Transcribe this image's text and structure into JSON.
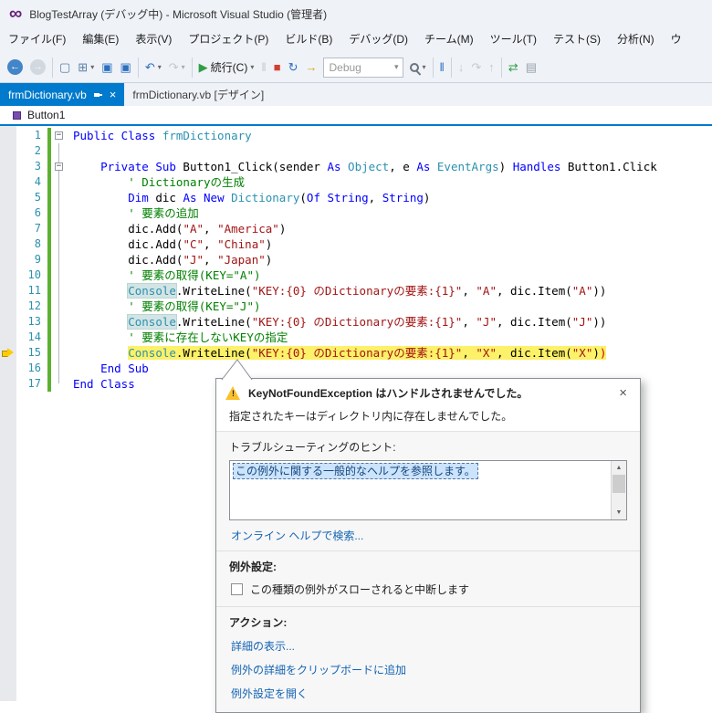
{
  "colors": {
    "accent": "#007acc",
    "keyword": "#0000ff",
    "type": "#2b91af",
    "string": "#a31515",
    "comment": "#008000",
    "current_statement_highlight": "#fcf168",
    "link": "#1464b4",
    "change_bar": "#5bb12f"
  },
  "titlebar": {
    "title": "BlogTestArray (デバッグ中) - Microsoft Visual Studio (管理者)"
  },
  "menubar": {
    "items": [
      "ファイル(F)",
      "編集(E)",
      "表示(V)",
      "プロジェクト(P)",
      "ビルド(B)",
      "デバッグ(D)",
      "チーム(M)",
      "ツール(T)",
      "テスト(S)",
      "分析(N)",
      "ウ"
    ]
  },
  "toolbar": {
    "items": [
      {
        "name": "navigate-backward-button",
        "glyph": "←",
        "style": "circle-blue"
      },
      {
        "name": "navigate-forward-button",
        "glyph": "→",
        "style": "circle-gray",
        "disabled": true
      },
      {
        "sep": true
      },
      {
        "name": "new-window-button",
        "glyph": "▢",
        "style": "steel"
      },
      {
        "name": "add-new-item-button",
        "glyph": "⊞",
        "style": "steel",
        "dropdown": true
      },
      {
        "name": "save-button",
        "glyph": "▣",
        "style": "blue"
      },
      {
        "name": "save-all-button",
        "glyph": "▣",
        "style": "blue"
      },
      {
        "sep": true
      },
      {
        "name": "undo-button",
        "glyph": "↶",
        "style": "blue",
        "dropdown": true
      },
      {
        "name": "redo-button",
        "glyph": "↷",
        "style": "gray",
        "dropdown": true,
        "disabled": true
      },
      {
        "sep": true
      },
      {
        "name": "continue-button",
        "glyph": "▶",
        "style": "green",
        "label": "続行(C)",
        "dropdown": true
      },
      {
        "name": "break-all-button",
        "glyph": "‖",
        "style": "gray",
        "disabled": true
      },
      {
        "name": "stop-debugging-button",
        "glyph": "■",
        "style": "red"
      },
      {
        "name": "restart-button",
        "glyph": "↻",
        "style": "blue"
      },
      {
        "name": "show-next-statement-button",
        "glyph": "→",
        "style": "yellow"
      },
      {
        "combo": true,
        "name": "solution-configuration-combo",
        "value": "Debug"
      },
      {
        "name": "find-button",
        "style": "mag",
        "dropdown": true
      },
      {
        "sep": true
      },
      {
        "name": "break-all-2-button",
        "glyph": "‖",
        "style": "blue"
      },
      {
        "sep": true
      },
      {
        "name": "step-into-button",
        "glyph": "↓",
        "style": "gray",
        "disabled": true
      },
      {
        "name": "step-over-button",
        "glyph": "↷",
        "style": "gray",
        "disabled": true
      },
      {
        "name": "step-out-button",
        "glyph": "↑",
        "style": "gray",
        "disabled": true
      },
      {
        "sep": true
      },
      {
        "name": "sync-button",
        "glyph": "⇄",
        "style": "green"
      },
      {
        "name": "list-button",
        "glyph": "▤",
        "style": "gray"
      }
    ]
  },
  "tabs": [
    {
      "label": "frmDictionary.vb",
      "active": true
    },
    {
      "label": "frmDictionary.vb [デザイン]",
      "active": false
    }
  ],
  "navbar": {
    "scope": "Button1"
  },
  "editor": {
    "current_line": 15,
    "lines": [
      {
        "n": 1,
        "fold": true,
        "indent": 0,
        "tokens": [
          [
            "Public Class ",
            "kw"
          ],
          [
            "frmDictionary",
            "type"
          ]
        ]
      },
      {
        "n": 2,
        "indent": 0,
        "tokens": []
      },
      {
        "n": 3,
        "fold": true,
        "indent": 4,
        "tokens": [
          [
            "Private Sub ",
            "kw"
          ],
          [
            "Button1_Click(sender ",
            "plain"
          ],
          [
            "As ",
            "kw"
          ],
          [
            "Object",
            "type"
          ],
          [
            ", e ",
            "plain"
          ],
          [
            "As ",
            "kw"
          ],
          [
            "EventArgs",
            "type"
          ],
          [
            ") ",
            "plain"
          ],
          [
            "Handles ",
            "kw"
          ],
          [
            "Button1.Click",
            "plain"
          ]
        ]
      },
      {
        "n": 4,
        "indent": 8,
        "tokens": [
          [
            "' Dictionaryの生成",
            "com"
          ]
        ]
      },
      {
        "n": 5,
        "indent": 8,
        "tokens": [
          [
            "Dim ",
            "kw"
          ],
          [
            "dic ",
            "plain"
          ],
          [
            "As New ",
            "kw"
          ],
          [
            "Dictionary",
            "type"
          ],
          [
            "(",
            "plain"
          ],
          [
            "Of ",
            "kw"
          ],
          [
            "String",
            "kw"
          ],
          [
            ", ",
            "plain"
          ],
          [
            "String",
            "kw"
          ],
          [
            ")",
            "plain"
          ]
        ]
      },
      {
        "n": 6,
        "indent": 8,
        "tokens": [
          [
            "' 要素の追加",
            "com"
          ]
        ]
      },
      {
        "n": 7,
        "indent": 8,
        "tokens": [
          [
            "dic.Add(",
            "plain"
          ],
          [
            "\"A\"",
            "str"
          ],
          [
            ", ",
            "plain"
          ],
          [
            "\"America\"",
            "str"
          ],
          [
            ")",
            "plain"
          ]
        ]
      },
      {
        "n": 8,
        "indent": 8,
        "tokens": [
          [
            "dic.Add(",
            "plain"
          ],
          [
            "\"C\"",
            "str"
          ],
          [
            ", ",
            "plain"
          ],
          [
            "\"China\"",
            "str"
          ],
          [
            ")",
            "plain"
          ]
        ]
      },
      {
        "n": 9,
        "indent": 8,
        "tokens": [
          [
            "dic.Add(",
            "plain"
          ],
          [
            "\"J\"",
            "str"
          ],
          [
            ", ",
            "plain"
          ],
          [
            "\"Japan\"",
            "str"
          ],
          [
            ")",
            "plain"
          ]
        ]
      },
      {
        "n": 10,
        "indent": 8,
        "tokens": [
          [
            "' 要素の取得(KEY=\"A\")",
            "com"
          ]
        ]
      },
      {
        "n": 11,
        "indent": 8,
        "tokens": [
          [
            "Console",
            "typehl"
          ],
          [
            ".WriteLine(",
            "plain"
          ],
          [
            "\"KEY:{0} のDictionaryの要素:{1}\"",
            "str"
          ],
          [
            ", ",
            "plain"
          ],
          [
            "\"A\"",
            "str"
          ],
          [
            ", dic.Item(",
            "plain"
          ],
          [
            "\"A\"",
            "str"
          ],
          [
            "))",
            "plain"
          ]
        ]
      },
      {
        "n": 12,
        "indent": 8,
        "tokens": [
          [
            "' 要素の取得(KEY=\"J\")",
            "com"
          ]
        ]
      },
      {
        "n": 13,
        "indent": 8,
        "tokens": [
          [
            "Console",
            "typehl"
          ],
          [
            ".WriteLine(",
            "plain"
          ],
          [
            "\"KEY:{0} のDictionaryの要素:{1}\"",
            "str"
          ],
          [
            ", ",
            "plain"
          ],
          [
            "\"J\"",
            "str"
          ],
          [
            ", dic.Item(",
            "plain"
          ],
          [
            "\"J\"",
            "str"
          ],
          [
            "))",
            "plain"
          ]
        ]
      },
      {
        "n": 14,
        "indent": 8,
        "tokens": [
          [
            "' 要素に存在しないKEYの指定",
            "com"
          ]
        ]
      },
      {
        "n": 15,
        "indent": 8,
        "tokens": [
          [
            "Console",
            "type"
          ],
          [
            ".WriteLine(",
            "plain"
          ],
          [
            "\"KEY:{0} のDictionaryの要素:{1}\"",
            "str"
          ],
          [
            ", ",
            "plain"
          ],
          [
            "\"X\"",
            "str"
          ],
          [
            ", dic.Item(",
            "plain"
          ],
          [
            "\"X\"",
            "str"
          ],
          [
            ")",
            "plain"
          ],
          [
            ")",
            "err"
          ]
        ]
      },
      {
        "n": 16,
        "indent": 4,
        "tokens": [
          [
            "End Sub",
            "kw"
          ]
        ]
      },
      {
        "n": 17,
        "indent": 0,
        "tokens": [
          [
            "End Class",
            "kw"
          ]
        ]
      }
    ]
  },
  "exception_dialog": {
    "title": "KeyNotFoundException はハンドルされませんでした。",
    "message": "指定されたキーはディレクトリ内に存在しませんでした。",
    "tips_label": "トラブルシューティングのヒント:",
    "tips": [
      "この例外に関する一般的なヘルプを参照します。"
    ],
    "search_link": "オンライン ヘルプで検索...",
    "settings_label": "例外設定:",
    "break_checkbox_label": "この種類の例外がスローされると中断します",
    "checkbox_checked": false,
    "actions_label": "アクション:",
    "actions": [
      "詳細の表示...",
      "例外の詳細をクリップボードに追加",
      "例外設定を開く"
    ]
  }
}
